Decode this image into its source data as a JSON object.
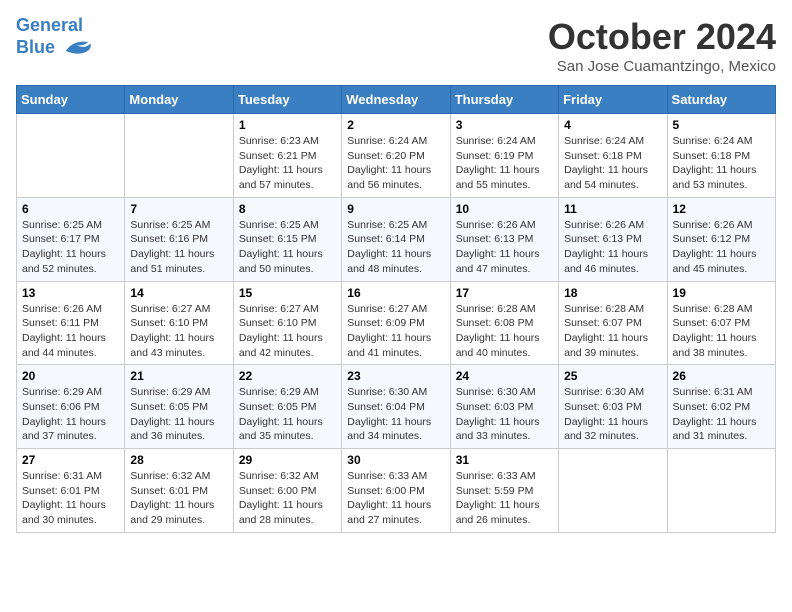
{
  "header": {
    "logo_line1": "General",
    "logo_line2": "Blue",
    "month": "October 2024",
    "location": "San Jose Cuamantzingo, Mexico"
  },
  "days_of_week": [
    "Sunday",
    "Monday",
    "Tuesday",
    "Wednesday",
    "Thursday",
    "Friday",
    "Saturday"
  ],
  "weeks": [
    [
      {
        "day": "",
        "info": ""
      },
      {
        "day": "",
        "info": ""
      },
      {
        "day": "1",
        "info": "Sunrise: 6:23 AM\nSunset: 6:21 PM\nDaylight: 11 hours and 57 minutes."
      },
      {
        "day": "2",
        "info": "Sunrise: 6:24 AM\nSunset: 6:20 PM\nDaylight: 11 hours and 56 minutes."
      },
      {
        "day": "3",
        "info": "Sunrise: 6:24 AM\nSunset: 6:19 PM\nDaylight: 11 hours and 55 minutes."
      },
      {
        "day": "4",
        "info": "Sunrise: 6:24 AM\nSunset: 6:18 PM\nDaylight: 11 hours and 54 minutes."
      },
      {
        "day": "5",
        "info": "Sunrise: 6:24 AM\nSunset: 6:18 PM\nDaylight: 11 hours and 53 minutes."
      }
    ],
    [
      {
        "day": "6",
        "info": "Sunrise: 6:25 AM\nSunset: 6:17 PM\nDaylight: 11 hours and 52 minutes."
      },
      {
        "day": "7",
        "info": "Sunrise: 6:25 AM\nSunset: 6:16 PM\nDaylight: 11 hours and 51 minutes."
      },
      {
        "day": "8",
        "info": "Sunrise: 6:25 AM\nSunset: 6:15 PM\nDaylight: 11 hours and 50 minutes."
      },
      {
        "day": "9",
        "info": "Sunrise: 6:25 AM\nSunset: 6:14 PM\nDaylight: 11 hours and 48 minutes."
      },
      {
        "day": "10",
        "info": "Sunrise: 6:26 AM\nSunset: 6:13 PM\nDaylight: 11 hours and 47 minutes."
      },
      {
        "day": "11",
        "info": "Sunrise: 6:26 AM\nSunset: 6:13 PM\nDaylight: 11 hours and 46 minutes."
      },
      {
        "day": "12",
        "info": "Sunrise: 6:26 AM\nSunset: 6:12 PM\nDaylight: 11 hours and 45 minutes."
      }
    ],
    [
      {
        "day": "13",
        "info": "Sunrise: 6:26 AM\nSunset: 6:11 PM\nDaylight: 11 hours and 44 minutes."
      },
      {
        "day": "14",
        "info": "Sunrise: 6:27 AM\nSunset: 6:10 PM\nDaylight: 11 hours and 43 minutes."
      },
      {
        "day": "15",
        "info": "Sunrise: 6:27 AM\nSunset: 6:10 PM\nDaylight: 11 hours and 42 minutes."
      },
      {
        "day": "16",
        "info": "Sunrise: 6:27 AM\nSunset: 6:09 PM\nDaylight: 11 hours and 41 minutes."
      },
      {
        "day": "17",
        "info": "Sunrise: 6:28 AM\nSunset: 6:08 PM\nDaylight: 11 hours and 40 minutes."
      },
      {
        "day": "18",
        "info": "Sunrise: 6:28 AM\nSunset: 6:07 PM\nDaylight: 11 hours and 39 minutes."
      },
      {
        "day": "19",
        "info": "Sunrise: 6:28 AM\nSunset: 6:07 PM\nDaylight: 11 hours and 38 minutes."
      }
    ],
    [
      {
        "day": "20",
        "info": "Sunrise: 6:29 AM\nSunset: 6:06 PM\nDaylight: 11 hours and 37 minutes."
      },
      {
        "day": "21",
        "info": "Sunrise: 6:29 AM\nSunset: 6:05 PM\nDaylight: 11 hours and 36 minutes."
      },
      {
        "day": "22",
        "info": "Sunrise: 6:29 AM\nSunset: 6:05 PM\nDaylight: 11 hours and 35 minutes."
      },
      {
        "day": "23",
        "info": "Sunrise: 6:30 AM\nSunset: 6:04 PM\nDaylight: 11 hours and 34 minutes."
      },
      {
        "day": "24",
        "info": "Sunrise: 6:30 AM\nSunset: 6:03 PM\nDaylight: 11 hours and 33 minutes."
      },
      {
        "day": "25",
        "info": "Sunrise: 6:30 AM\nSunset: 6:03 PM\nDaylight: 11 hours and 32 minutes."
      },
      {
        "day": "26",
        "info": "Sunrise: 6:31 AM\nSunset: 6:02 PM\nDaylight: 11 hours and 31 minutes."
      }
    ],
    [
      {
        "day": "27",
        "info": "Sunrise: 6:31 AM\nSunset: 6:01 PM\nDaylight: 11 hours and 30 minutes."
      },
      {
        "day": "28",
        "info": "Sunrise: 6:32 AM\nSunset: 6:01 PM\nDaylight: 11 hours and 29 minutes."
      },
      {
        "day": "29",
        "info": "Sunrise: 6:32 AM\nSunset: 6:00 PM\nDaylight: 11 hours and 28 minutes."
      },
      {
        "day": "30",
        "info": "Sunrise: 6:33 AM\nSunset: 6:00 PM\nDaylight: 11 hours and 27 minutes."
      },
      {
        "day": "31",
        "info": "Sunrise: 6:33 AM\nSunset: 5:59 PM\nDaylight: 11 hours and 26 minutes."
      },
      {
        "day": "",
        "info": ""
      },
      {
        "day": "",
        "info": ""
      }
    ]
  ]
}
